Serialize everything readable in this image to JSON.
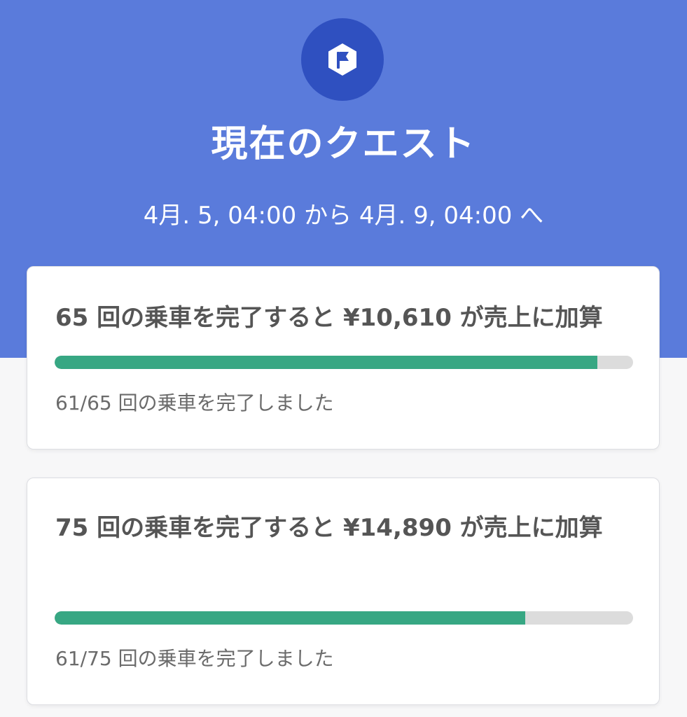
{
  "header": {
    "icon": "flag-icon",
    "title": "現在のクエスト",
    "period": "4月. 5, 04:00 から 4月. 9, 04:00 へ",
    "colors": {
      "background": "#5a7bdb",
      "badge": "#2f50c0"
    }
  },
  "quests": [
    {
      "title": "65 回の乗車を完了すると ¥10,610 が売上に加算",
      "progress": 0.938,
      "progress_text": "61/65 回の乗車を完了しました"
    },
    {
      "title": "75 回の乗車を完了すると ¥14,890 が売上に加算",
      "progress": 0.813,
      "progress_text": "61/75 回の乗車を完了しました"
    }
  ],
  "colors": {
    "progress_fill": "#37a783",
    "progress_track": "#dcdcdc"
  }
}
